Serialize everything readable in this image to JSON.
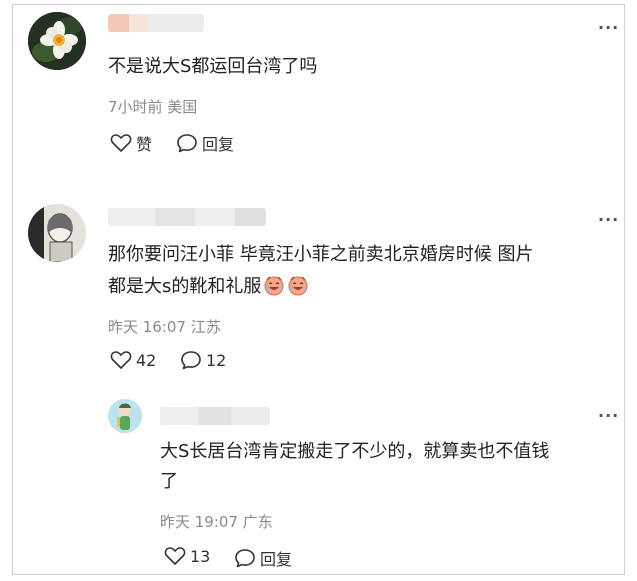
{
  "comments": [
    {
      "text": "不是说大S都运回台湾了吗",
      "meta": "7小时前 美国",
      "like_label": "赞",
      "reply_label": "回复"
    },
    {
      "text_line1": "那你要问汪小菲 毕竟汪小菲之前卖北京婚房时候 图片",
      "text_line2": "都是大s的靴和礼服",
      "meta": "昨天 16:07 江苏",
      "like_count": "42",
      "reply_count": "12"
    },
    {
      "text_line1": "大S长居台湾肯定搬走了不少的，就算卖也不值钱",
      "text_line2": "了",
      "meta": "昨天 19:07 广东",
      "like_count": "13",
      "reply_label": "回复"
    }
  ],
  "more_label": "···",
  "icons": [
    "heart-icon",
    "comment-bubble-icon",
    "more-icon",
    "laughing-emoji-icon"
  ]
}
